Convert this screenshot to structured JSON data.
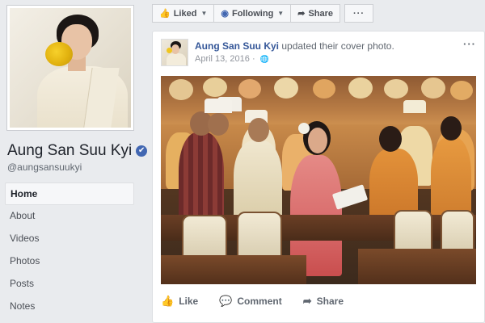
{
  "page": {
    "name": "Aung San Suu Kyi",
    "handle": "@aungsansuukyi",
    "verified_glyph": "✔"
  },
  "nav": {
    "items": [
      "Home",
      "About",
      "Videos",
      "Photos",
      "Posts",
      "Notes"
    ],
    "active": "Home"
  },
  "action_bar": {
    "liked_label": "Liked",
    "following_label": "Following",
    "share_label": "Share",
    "more_label": "···"
  },
  "post": {
    "author": "Aung San Suu Kyi",
    "action_text": "updated their cover photo.",
    "date": "April 13, 2016",
    "more_label": "···"
  },
  "post_actions": {
    "like_label": "Like",
    "comment_label": "Comment",
    "share_label": "Share"
  },
  "icons": [
    "thumbs-up-icon",
    "rss-icon",
    "share-arrow-icon",
    "globe-icon",
    "comment-icon",
    "verified-icon"
  ],
  "colors": {
    "brand_blue": "#4267b2",
    "link_blue": "#365899",
    "background": "#e9ebee"
  }
}
